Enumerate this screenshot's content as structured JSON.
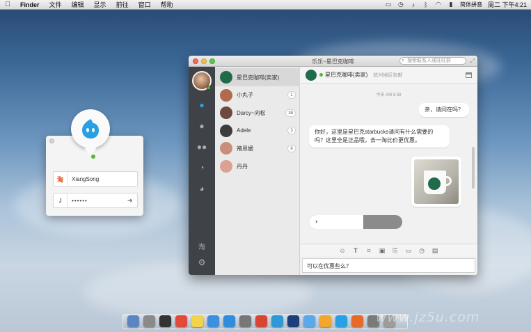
{
  "menubar": {
    "apple": "",
    "items": [
      "Finder",
      "文件",
      "编辑",
      "显示",
      "前往",
      "窗口",
      "帮助"
    ],
    "ime": "简体拼音",
    "clock": "周二 下午4:21"
  },
  "login": {
    "username": "XiangSong",
    "password": "••••••",
    "username_prefix": "淘"
  },
  "window": {
    "title": "乐乐~星巴克咖啡",
    "search_placeholder": "搜索联系人或旺旺群"
  },
  "contacts": [
    {
      "name": "星巴克咖啡(卖家)",
      "count": "",
      "color": "#1f6b4a"
    },
    {
      "name": "小丸子",
      "count": "1",
      "color": "#b06a4c"
    },
    {
      "name": "Darcy~向松",
      "count": "38",
      "color": "#6d4a3e"
    },
    {
      "name": "Adele",
      "count": "3",
      "color": "#3c3c3c"
    },
    {
      "name": "褚思媛",
      "count": "8",
      "color": "#c98f7c"
    },
    {
      "name": "丹丹",
      "count": "",
      "color": "#d9a292"
    }
  ],
  "chat": {
    "name": "星巴克咖啡(卖家)",
    "subtitle": "杭州地区包邮",
    "timestamp": "今天  AM 8:38",
    "msg_out": "亲，请问在吗？",
    "msg_in": "你好，这里是星巴克starbucks请问有什么需要的吗？这里全是正品哦，去一淘比价更优惠。",
    "voice_progress": 0.58,
    "input_text": "可以在优惠些么？"
  },
  "rail": {
    "shop_glyph": "淘"
  },
  "colors": {
    "accent_blue": "#2aa0e4",
    "online_green": "#5ab636",
    "rail_bg": "#3f4347"
  },
  "watermark": "www.jz5u.com",
  "icons": [
    "apple-icon",
    "clock-icon",
    "volume-icon",
    "bluetooth-icon",
    "wifi-icon",
    "search-icon",
    "chat-icon",
    "contacts-icon",
    "group-icon",
    "history-icon",
    "settings-icon",
    "emoji-icon",
    "text-format-icon",
    "screenshot-icon",
    "image-icon",
    "file-icon",
    "window-icon",
    "timer-icon",
    "history-log-icon",
    "voice-icon"
  ]
}
